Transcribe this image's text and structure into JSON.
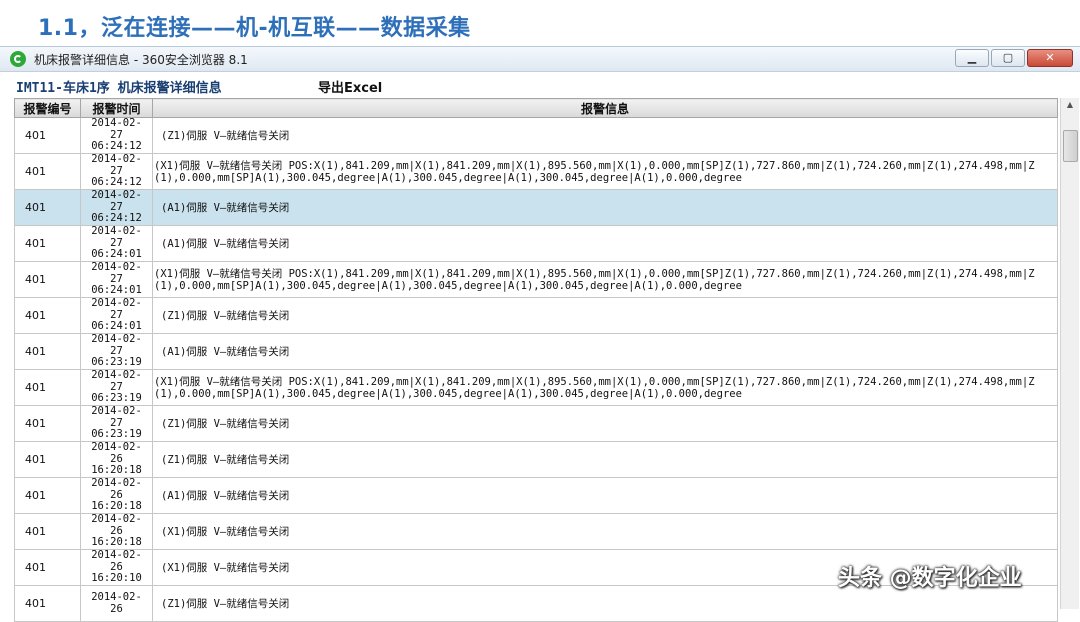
{
  "slide": {
    "title": "1.1，泛在连接——机-机互联——数据采集"
  },
  "window": {
    "title": "机床报警详细信息 - 360安全浏览器 8.1",
    "buttons": {
      "minimize": "▁",
      "maximize": "▢",
      "close": "✕"
    }
  },
  "page": {
    "title": "IMT11-车床1序 机床报警详细信息",
    "export_label": "导出Excel"
  },
  "table": {
    "headers": [
      "报警编号",
      "报警时间",
      "报警信息"
    ],
    "rows": [
      {
        "num": "401",
        "time": [
          "2014-02-",
          "27",
          "06:24:12"
        ],
        "msg": "(Z1)伺服 V—就绪信号关闭",
        "selected": false
      },
      {
        "num": "401",
        "time": [
          "2014-02-",
          "27",
          "06:24:12"
        ],
        "msg": "(X1)伺服 V—就绪信号关闭 POS:X(1),841.209,mm|X(1),841.209,mm|X(1),895.560,mm|X(1),0.000,mm[SP]Z(1),727.860,mm|Z(1),724.260,mm|Z(1),274.498,mm|Z(1),0.000,mm[SP]A(1),300.045,degree|A(1),300.045,degree|A(1),300.045,degree|A(1),0.000,degree",
        "selected": false
      },
      {
        "num": "401",
        "time": [
          "2014-02-",
          "27",
          "06:24:12"
        ],
        "msg": "(A1)伺服 V—就绪信号关闭",
        "selected": true
      },
      {
        "num": "401",
        "time": [
          "2014-02-",
          "27",
          "06:24:01"
        ],
        "msg": "(A1)伺服 V—就绪信号关闭",
        "selected": false
      },
      {
        "num": "401",
        "time": [
          "2014-02-",
          "27",
          "06:24:01"
        ],
        "msg": "(X1)伺服 V—就绪信号关闭 POS:X(1),841.209,mm|X(1),841.209,mm|X(1),895.560,mm|X(1),0.000,mm[SP]Z(1),727.860,mm|Z(1),724.260,mm|Z(1),274.498,mm|Z(1),0.000,mm[SP]A(1),300.045,degree|A(1),300.045,degree|A(1),300.045,degree|A(1),0.000,degree",
        "selected": false
      },
      {
        "num": "401",
        "time": [
          "2014-02-",
          "27",
          "06:24:01"
        ],
        "msg": "(Z1)伺服 V—就绪信号关闭",
        "selected": false
      },
      {
        "num": "401",
        "time": [
          "2014-02-",
          "27",
          "06:23:19"
        ],
        "msg": "(A1)伺服 V—就绪信号关闭",
        "selected": false
      },
      {
        "num": "401",
        "time": [
          "2014-02-",
          "27",
          "06:23:19"
        ],
        "msg": "(X1)伺服 V—就绪信号关闭 POS:X(1),841.209,mm|X(1),841.209,mm|X(1),895.560,mm|X(1),0.000,mm[SP]Z(1),727.860,mm|Z(1),724.260,mm|Z(1),274.498,mm|Z(1),0.000,mm[SP]A(1),300.045,degree|A(1),300.045,degree|A(1),300.045,degree|A(1),0.000,degree",
        "selected": false
      },
      {
        "num": "401",
        "time": [
          "2014-02-",
          "27",
          "06:23:19"
        ],
        "msg": "(Z1)伺服 V—就绪信号关闭",
        "selected": false
      },
      {
        "num": "401",
        "time": [
          "2014-02-",
          "26",
          "16:20:18"
        ],
        "msg": "(Z1)伺服 V—就绪信号关闭",
        "selected": false
      },
      {
        "num": "401",
        "time": [
          "2014-02-",
          "26",
          "16:20:18"
        ],
        "msg": "(A1)伺服 V—就绪信号关闭",
        "selected": false
      },
      {
        "num": "401",
        "time": [
          "2014-02-",
          "26",
          "16:20:18"
        ],
        "msg": "(X1)伺服 V—就绪信号关闭",
        "selected": false
      },
      {
        "num": "401",
        "time": [
          "2014-02-",
          "26",
          "16:20:10"
        ],
        "msg": "(X1)伺服 V—就绪信号关闭",
        "selected": false
      },
      {
        "num": "401",
        "time": [
          "2014-02-",
          "26",
          ""
        ],
        "msg": "(Z1)伺服 V—就绪信号关闭",
        "selected": false
      }
    ]
  },
  "watermark": "头条 @数字化企业"
}
